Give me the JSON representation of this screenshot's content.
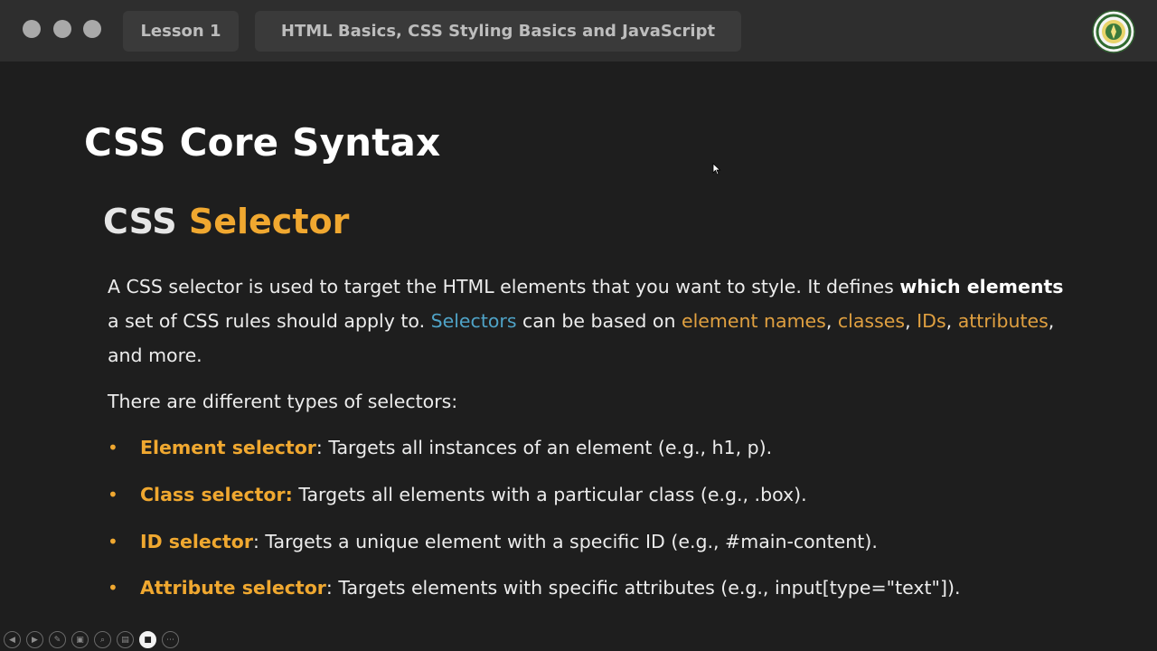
{
  "window": {
    "tabs": [
      {
        "label": "Lesson 1"
      },
      {
        "label": "HTML Basics, CSS Styling Basics and JavaScript"
      }
    ]
  },
  "slide": {
    "title": "CSS Core Syntax",
    "section_title_part1": "CSS",
    "section_title_part2": "Selector",
    "paragraph1": {
      "t1": "A CSS selector is used to target the HTML elements that you want to style. It defines ",
      "b1": "which elements",
      "t2": " a set of CSS rules should apply to. ",
      "blue1": "Selectors",
      "t3": " can be based on ",
      "o1": "element names",
      "t4": ", ",
      "o2": "classes",
      "t5": ", ",
      "o3": "IDs",
      "t6": ", ",
      "o4": "attributes",
      "t7": ", and more."
    },
    "paragraph2": "There are different types of selectors:",
    "bullets": [
      {
        "term": "Element selector",
        "text": ": Targets all instances of an element (e.g., h1, p)."
      },
      {
        "term": "Class selector:",
        "text": " Targets all elements with a particular class (e.g., .box)."
      },
      {
        "term": "ID selector",
        "text": ": Targets a unique element with a specific ID (e.g., #main-content)."
      },
      {
        "term": "Attribute selector",
        "text": ": Targets elements with specific attributes (e.g., input[type=\"text\"])."
      }
    ]
  },
  "colors": {
    "accent": "#f0a830",
    "link_blue": "#4fa3c7",
    "background": "#1e1e1e",
    "topbar": "#2e2e2e"
  },
  "controls": [
    {
      "icon": "prev-icon"
    },
    {
      "icon": "next-icon"
    },
    {
      "icon": "pen-icon"
    },
    {
      "icon": "slides-icon"
    },
    {
      "icon": "zoom-icon"
    },
    {
      "icon": "subtitles-icon"
    },
    {
      "icon": "camera-icon"
    },
    {
      "icon": "more-icon"
    }
  ]
}
